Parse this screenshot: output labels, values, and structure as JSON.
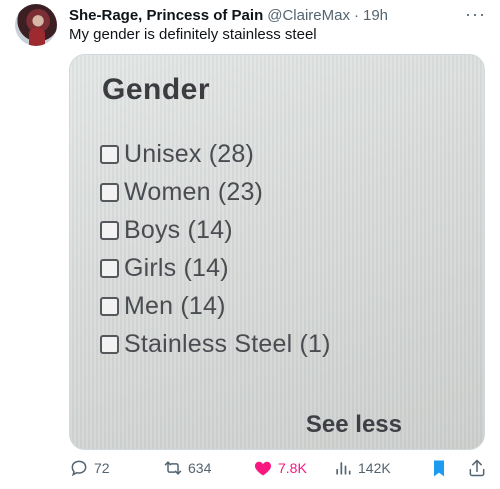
{
  "tweet": {
    "author_name": "She-Rage, Princess of Pain",
    "handle": "@ClaireMax",
    "separator": "·",
    "time": "19h",
    "more_icon": "more-horizontal-icon",
    "text": "My gender is definitely stainless steel"
  },
  "media": {
    "filter_title": "Gender",
    "options": [
      {
        "label": "Unisex (28)",
        "checked": false
      },
      {
        "label": "Women (23)",
        "checked": false
      },
      {
        "label": "Boys (14)",
        "checked": false
      },
      {
        "label": "Girls (14)",
        "checked": false
      },
      {
        "label": "Men (14)",
        "checked": false
      },
      {
        "label": "Stainless Steel (1)",
        "checked": false
      }
    ],
    "see_less": "See less"
  },
  "actions": {
    "replies": "72",
    "retweets": "634",
    "likes": "7.8K",
    "views": "142K",
    "like_color": "#f91880",
    "icon_color": "#536471",
    "bookmark_color": "#1d9bf0"
  }
}
